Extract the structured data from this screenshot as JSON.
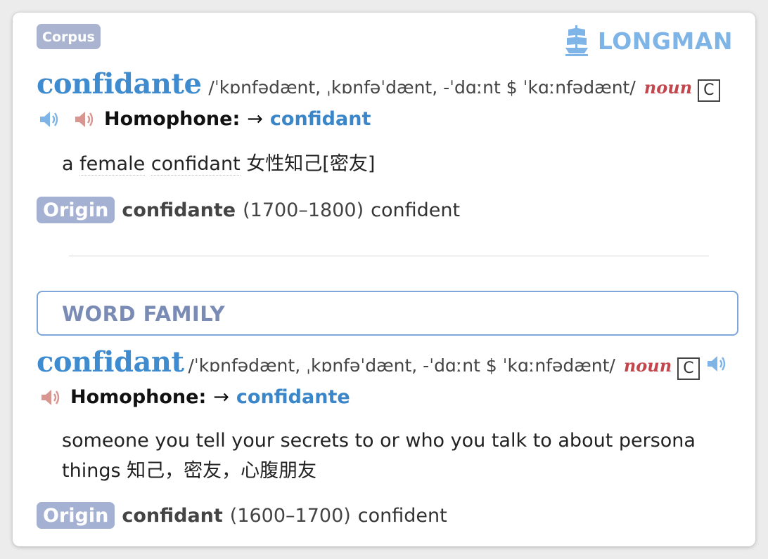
{
  "header": {
    "corpus_label": "Corpus",
    "logo_text": "LONGMAN"
  },
  "entry1": {
    "headword": "confidante",
    "pronunciation": "/ˈkɒnfədænt, ˌkɒnfəˈdænt, -ˈdɑːnt $ ˈkɑːnfədænt/",
    "pos": "noun",
    "grammar": "C",
    "homophone_label": "Homophone:",
    "homophone_arrow": "→",
    "homophone_link": "confidant",
    "definition_words": [
      "a",
      "female",
      "confidant"
    ],
    "definition_translation": "女性知己[密友]",
    "origin_badge": "Origin",
    "origin_word": "confidante",
    "origin_date": "(1700–1800)",
    "origin_source": "confident"
  },
  "word_family": {
    "title": "WORD FAMILY"
  },
  "entry2": {
    "headword": "confidant",
    "pronunciation": "/ˈkɒnfədænt, ˌkɒnfəˈdænt, -ˈdɑːnt $ ˈkɑːnfədænt/",
    "pos": "noun",
    "grammar": "C",
    "homophone_label": "Homophone:",
    "homophone_arrow": "→",
    "homophone_link": "confidante",
    "definition_line1": "someone you tell your secrets to or who you talk to about persona",
    "definition_line2_word": "things",
    "definition_translation": "知己，密友，心腹朋友",
    "origin_badge": "Origin",
    "origin_word": "confidant",
    "origin_date": "(1600–1700)",
    "origin_source": "confident"
  },
  "colors": {
    "headword": "#3e8ccf",
    "pos": "#c3464c",
    "badge": "#a4b1d2",
    "link": "#3a86c8",
    "logo": "#7fb4e6",
    "speaker_uk": "#7fb4e6",
    "speaker_us": "#d9958f"
  },
  "icons": [
    "ship-logo-icon",
    "speaker-uk-icon",
    "speaker-us-icon"
  ]
}
